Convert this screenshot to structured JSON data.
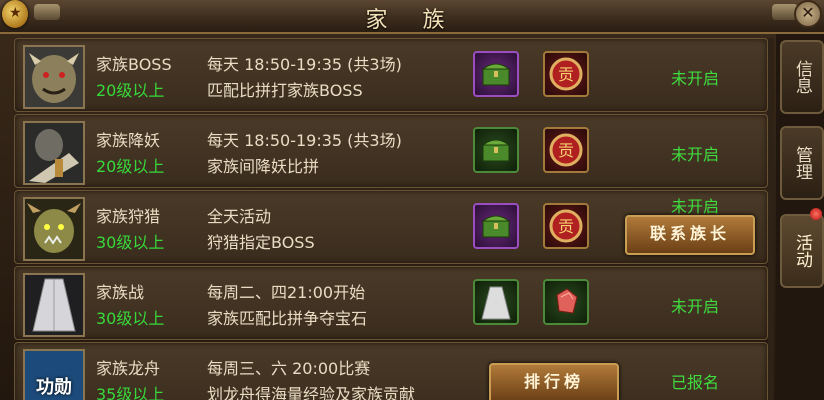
{
  "window": {
    "title": "家 族",
    "emblem_glyph": "★",
    "close_glyph": "✕"
  },
  "side_tabs": [
    {
      "label": "信息",
      "active": false
    },
    {
      "label": "管理",
      "active": false
    },
    {
      "label": "活动",
      "active": true
    }
  ],
  "events": [
    {
      "name": "家族BOSS",
      "level": "20级以上",
      "time": "每天 18:50-19:35 (共3场)",
      "desc": "匹配比拼打家族BOSS",
      "status": "未开启",
      "rewards": [
        "treasure-chest-icon",
        "contribution-badge-icon"
      ],
      "portrait": "boss-portrait"
    },
    {
      "name": "家族降妖",
      "level": "20级以上",
      "time": "每天 18:50-19:35 (共3场)",
      "desc": "家族间降妖比拼",
      "status": "未开启",
      "rewards": [
        "treasure-chest-icon",
        "contribution-badge-icon"
      ],
      "portrait": "warrior-portrait"
    },
    {
      "name": "家族狩猎",
      "level": "30级以上",
      "time": "全天活动",
      "desc": "狩猎指定BOSS",
      "status": "未开启",
      "button": "联系族长",
      "rewards": [
        "treasure-chest-icon",
        "contribution-badge-icon"
      ],
      "portrait": "orc-portrait"
    },
    {
      "name": "家族战",
      "level": "30级以上",
      "time": "每周二、四21:00开始",
      "desc": "家族匹配比拼争夺宝石",
      "status": "未开启",
      "rewards": [
        "white-robe-icon",
        "red-gem-icon"
      ],
      "portrait": "robe-portrait"
    },
    {
      "name": "家族龙舟",
      "level": "35级以上",
      "time": "每周三、六 20:00比赛",
      "desc": "划龙舟得海量经验及家族贡献",
      "status": "已报名",
      "button": "排行榜",
      "portrait_text": "功勋",
      "portrait": "merit-portrait"
    }
  ]
}
